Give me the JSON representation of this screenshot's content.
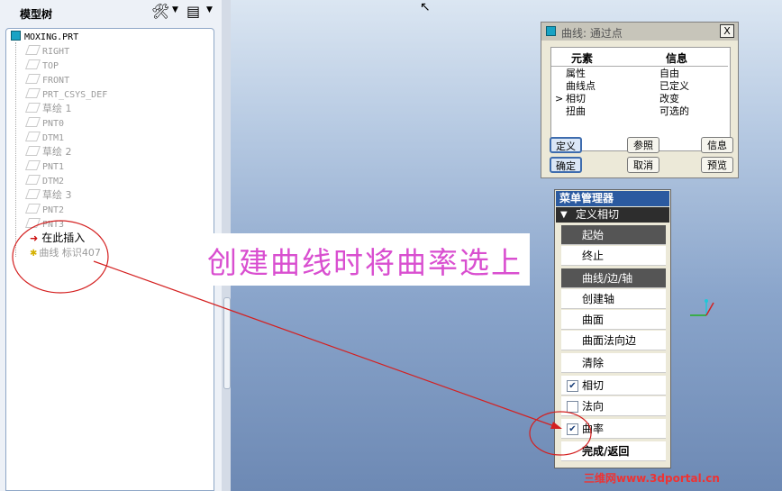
{
  "tree": {
    "title": "模型树",
    "root": "MOXING.PRT",
    "items": [
      {
        "label": "RIGHT",
        "icon": "datum-plane-icon"
      },
      {
        "label": "TOP",
        "icon": "datum-plane-icon"
      },
      {
        "label": "FRONT",
        "icon": "datum-plane-icon"
      },
      {
        "label": "PRT_CSYS_DEF",
        "icon": "csys-icon"
      },
      {
        "label": "草绘 1",
        "icon": "sketch-icon"
      },
      {
        "label": "PNT0",
        "icon": "datum-point-icon"
      },
      {
        "label": "DTM1",
        "icon": "datum-plane-icon"
      },
      {
        "label": "草绘 2",
        "icon": "sketch-icon"
      },
      {
        "label": "PNT1",
        "icon": "datum-point-icon"
      },
      {
        "label": "DTM2",
        "icon": "datum-plane-icon"
      },
      {
        "label": "草绘 3",
        "icon": "sketch-icon"
      },
      {
        "label": "PNT2",
        "icon": "datum-point-icon"
      },
      {
        "label": "PNT3",
        "icon": "datum-point-icon"
      }
    ],
    "insert_here": "在此插入",
    "curve_item": "曲线 标识407"
  },
  "annotation": "创建曲线时将曲率选上",
  "dialog": {
    "title": "曲线: 通过点",
    "close": "X",
    "col_element": "元素",
    "col_info": "信息",
    "rows": [
      {
        "element": "属性",
        "info": "自由",
        "marker": ""
      },
      {
        "element": "曲线点",
        "info": "已定义",
        "marker": ""
      },
      {
        "element": "相切",
        "info": "改变",
        "marker": ">"
      },
      {
        "element": "扭曲",
        "info": "可选的",
        "marker": ""
      }
    ],
    "buttons": {
      "define": "定义",
      "reference": "参照",
      "info": "信息",
      "ok": "确定",
      "cancel": "取消",
      "preview": "预览"
    }
  },
  "menu": {
    "title": "菜单管理器",
    "subtitle": "定义相切",
    "items": {
      "start": "起始",
      "end": "终止",
      "curve_edge_axis": "曲线/边/轴",
      "create_axis": "创建轴",
      "surface": "曲面",
      "surface_normal_edge": "曲面法向边",
      "clear": "清除",
      "tangent": "相切",
      "normal": "法向",
      "curvature": "曲率",
      "done_return": "完成/返回"
    },
    "checked": {
      "tangent": true,
      "normal": false,
      "curvature": true
    }
  },
  "watermark": "三维网www.3dportal.cn",
  "colors": {
    "annotation": "#d94fd0",
    "arrow": "#d42020",
    "menu_title": "#2b5aa0"
  }
}
